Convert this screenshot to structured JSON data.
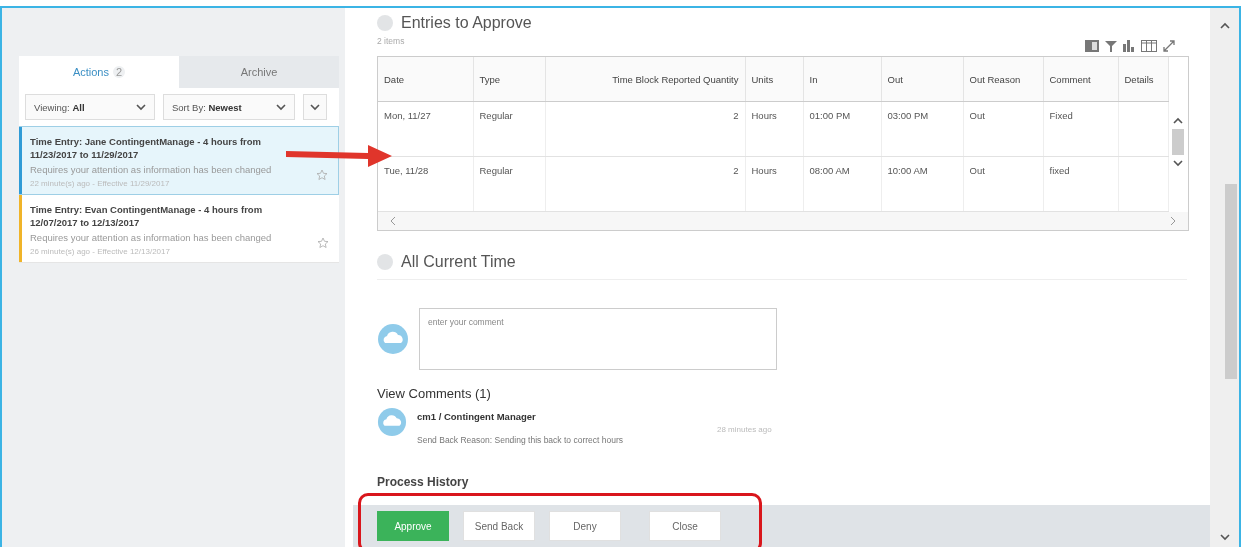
{
  "sidebar": {
    "tabs": [
      {
        "label": "Actions",
        "count": "2",
        "selected": true
      },
      {
        "label": "Archive",
        "selected": false
      }
    ],
    "filters": [
      {
        "label": "Viewing:",
        "value": "All"
      },
      {
        "label": "Sort By:",
        "value": "Newest"
      }
    ],
    "items": [
      {
        "title": "Time Entry: Jane ContingentManage - 4 hours from 11/23/2017 to 11/29/2017",
        "message": "Requires your attention as information has been changed",
        "meta": "22 minute(s) ago - Effective 11/29/2017",
        "selected": true,
        "color": "#2f9bd6"
      },
      {
        "title": "Time Entry: Evan ContingentManage - 4 hours from 12/07/2017 to 12/13/2017",
        "message": "Requires your attention as information has been changed",
        "meta": "26 minute(s) ago - Effective 12/13/2017",
        "selected": false,
        "color": "#f0b429"
      }
    ]
  },
  "entries": {
    "title": "Entries to Approve",
    "count": "2 items",
    "columns": [
      "Date",
      "Type",
      "Time Block Reported Quantity",
      "Units",
      "In",
      "Out",
      "Out Reason",
      "Comment",
      "Details"
    ],
    "rows": [
      [
        "Mon, 11/27",
        "Regular",
        "2",
        "Hours",
        "01:00 PM",
        "03:00 PM",
        "Out",
        "Fixed"
      ],
      [
        "Tue, 11/28",
        "Regular",
        "2",
        "Hours",
        "08:00 AM",
        "10:00 AM",
        "Out",
        "fixed"
      ]
    ]
  },
  "all_current_time": {
    "title": "All Current Time"
  },
  "comment_field": {
    "placeholder": "enter your comment"
  },
  "comments": {
    "title": "View Comments (1)",
    "items": [
      {
        "author": "cm1 / Contingent Manager",
        "time": "28 minutes ago",
        "text": "Send Back Reason: Sending this back to correct hours"
      }
    ]
  },
  "process_history": {
    "title": "Process History"
  },
  "actions": [
    {
      "label": "Approve",
      "kind": "primary"
    },
    {
      "label": "Send Back",
      "kind": "secondary"
    },
    {
      "label": "Deny",
      "kind": "secondary"
    },
    {
      "label": "Close",
      "kind": "secondary"
    }
  ]
}
